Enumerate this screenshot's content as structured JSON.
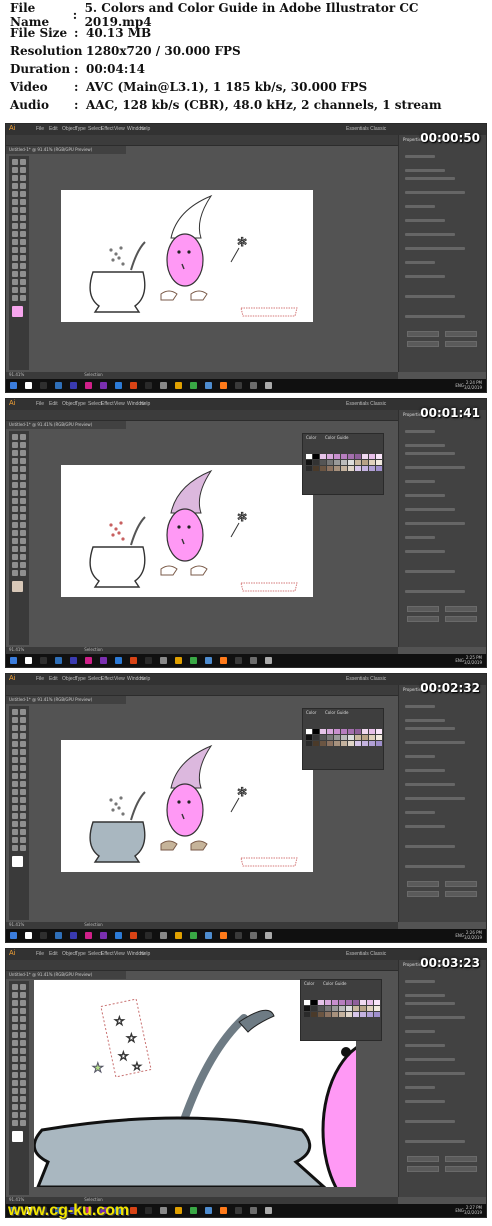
{
  "info": {
    "rows": [
      {
        "key": "File Name",
        "sep": ":",
        "value": "5. Colors and Color Guide in Adobe Illustrator CC 2019.mp4"
      },
      {
        "key": "File Size",
        "sep": ":",
        "value": "40.13 MB"
      },
      {
        "key": "Resolution",
        "sep": ":",
        "value": "1280x720 / 30.000 FPS"
      },
      {
        "key": "Duration",
        "sep": ":",
        "value": "00:04:14"
      },
      {
        "key": "Video",
        "sep": ":",
        "value": "AVC (Main@L3.1), 1 185 kb/s, 30.000 FPS"
      },
      {
        "key": "Audio",
        "sep": ":",
        "value": "AAC, 128 kb/s (CBR), 48.0 kHz, 2 channels, 1 stream"
      }
    ]
  },
  "app": {
    "logo": "Ai",
    "menu": [
      "File",
      "Edit",
      "Object",
      "Type",
      "Select",
      "Effect",
      "View",
      "Window",
      "Help"
    ],
    "workspace": "Essentials Classic",
    "doc_tab": "Untitled-1* @ 91.41% (RGB/GPU Preview)",
    "props_tabs": [
      "Properties",
      "Libraries"
    ],
    "swatch_tabs": [
      "Color",
      "Color Guide"
    ],
    "lang": "ENG",
    "status_left": "91.41%",
    "status_tool": "Selection"
  },
  "frames": [
    {
      "timestamp": "00:00:50",
      "clock_time": "2:24 PM",
      "clock_date": "3/2/2019",
      "show_swatches": false,
      "cauldron_fill": "#ffffff",
      "zoom": false
    },
    {
      "timestamp": "00:01:41",
      "clock_time": "2:25 PM",
      "clock_date": "3/2/2019",
      "show_swatches": true,
      "cauldron_fill": "#ffffff",
      "zoom": false
    },
    {
      "timestamp": "00:02:32",
      "clock_time": "2:26 PM",
      "clock_date": "3/2/2019",
      "show_swatches": true,
      "cauldron_fill": "#a9b7c0",
      "zoom": false
    },
    {
      "timestamp": "00:03:23",
      "clock_time": "2:27 PM",
      "clock_date": "3/2/2019",
      "show_swatches": true,
      "cauldron_fill": "#a9b7c0",
      "zoom": true
    }
  ],
  "colors": {
    "ui_bg": "#535353",
    "face_pink": "#ff99f5",
    "hat_pink": "#dcb8de",
    "cauldron_gray": "#a9b7c0",
    "fill_swatch_pink": "#f7a6ee",
    "timestamp_text": "#ffffff",
    "watermark": "#f3e600"
  },
  "watermark": "www.cg-ku.com"
}
